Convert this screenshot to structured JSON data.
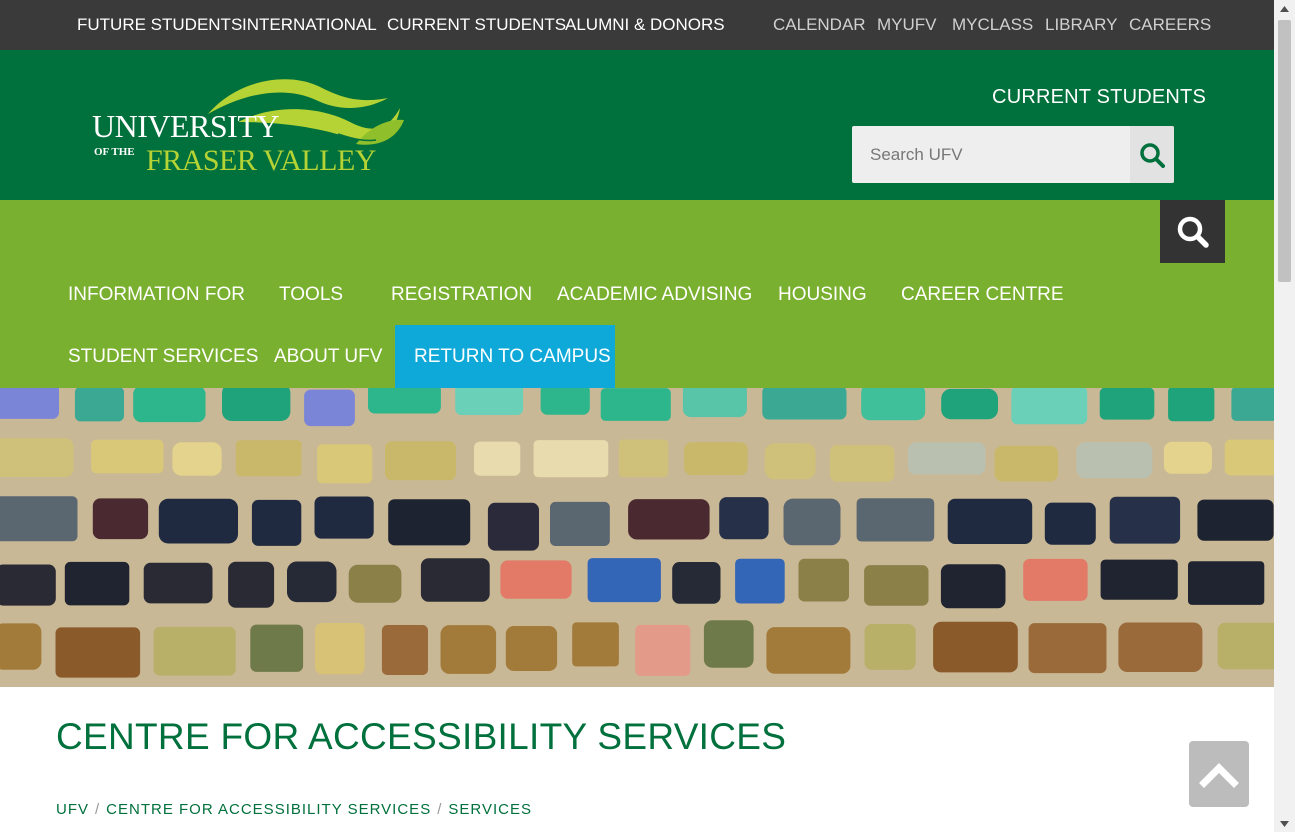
{
  "topbar": {
    "primary_links": [
      {
        "label": "FUTURE STUDENTS"
      },
      {
        "label": "INTERNATIONAL"
      },
      {
        "label": "CURRENT STUDENTS"
      },
      {
        "label": "ALUMNI & DONORS"
      }
    ],
    "secondary_links": [
      {
        "label": "CALENDAR"
      },
      {
        "label": "MYUFV"
      },
      {
        "label": "MYCLASS"
      },
      {
        "label": "LIBRARY"
      },
      {
        "label": "CAREERS"
      }
    ]
  },
  "header": {
    "logo": {
      "line1": "UNIVERSITY",
      "line2_small": "OF THE",
      "line2_large": "FRASER VALLEY"
    },
    "section_title": "CURRENT STUDENTS",
    "search": {
      "placeholder": "Search UFV",
      "button_icon": "search-icon"
    }
  },
  "mainnav": {
    "search_toggle_icon": "search-icon",
    "row1": [
      {
        "label": "INFORMATION FOR"
      },
      {
        "label": "TOOLS"
      },
      {
        "label": "REGISTRATION"
      },
      {
        "label": "ACADEMIC ADVISING"
      },
      {
        "label": "HOUSING"
      },
      {
        "label": "CAREER CENTRE"
      }
    ],
    "row2": [
      {
        "label": "STUDENT SERVICES"
      },
      {
        "label": "ABOUT UFV"
      },
      {
        "label": "RETURN TO CAMPUS"
      }
    ]
  },
  "main": {
    "page_title": "CENTRE FOR ACCESSIBILITY SERVICES",
    "breadcrumb": [
      {
        "label": "UFV"
      },
      {
        "label": "CENTRE FOR ACCESSIBILITY SERVICES"
      },
      {
        "label": "SERVICES"
      }
    ]
  },
  "back_to_top_icon": "chevron-up-icon",
  "colors": {
    "topbar": "#3a3a3a",
    "header_green": "#00703c",
    "nav_green": "#7ab02f",
    "nav_highlight": "#0fa9d9",
    "logo_lime": "#b5d334",
    "search_toggle": "#333333"
  }
}
